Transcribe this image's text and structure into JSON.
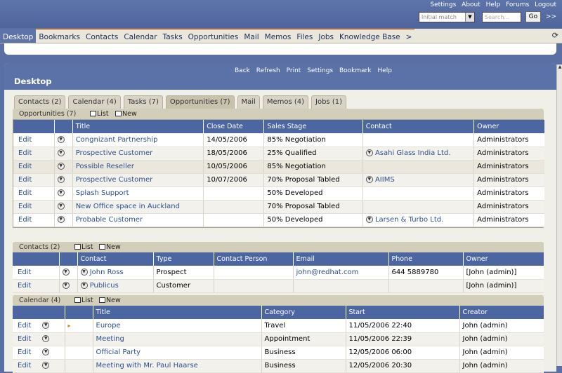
{
  "toplinks": [
    "Settings",
    "About",
    "Help",
    "Forums",
    "Logout"
  ],
  "search": {
    "match_select": "Initial match",
    "placeholder": "Search...",
    "go_label": "Go",
    "more_label": ">>"
  },
  "nav": {
    "tabs": [
      "Desktop",
      "Bookmarks",
      "Contacts",
      "Calendar",
      "Tasks",
      "Opportunities",
      "Mail",
      "Memos",
      "Files",
      "Jobs",
      "Knowledge Base",
      ">"
    ],
    "active": 0
  },
  "panel": {
    "links": [
      "Back",
      "Refresh",
      "Print",
      "Settings",
      "Bookmark",
      "Help"
    ],
    "title": "Desktop"
  },
  "subtabs": [
    "Contacts (2)",
    "Calendar (4)",
    "Tasks (7)",
    "Opportunities (7)",
    "Mail",
    "Memos (4)",
    "Jobs (1)"
  ],
  "common": {
    "edit": "Edit",
    "list": "List",
    "new": "New"
  },
  "opportunities": {
    "title": "Opportunities (7)",
    "columns": [
      "Title",
      "Close Date",
      "Sales Stage",
      "Contact",
      "Owner"
    ],
    "rows": [
      {
        "title": "Congnizant Partnership",
        "close": "14/05/2006",
        "stage": "85% Negotiation",
        "contact": "",
        "owner": "Administrators"
      },
      {
        "title": "Prospective Customer",
        "close": "18/05/2006",
        "stage": "25% Qualified",
        "contact": "Asahi Glass India Ltd.",
        "owner": "Administrators"
      },
      {
        "title": "Possible Reseller",
        "close": "10/05/2006",
        "stage": "85% Negotiation",
        "contact": "",
        "owner": "Administrators"
      },
      {
        "title": "Prospective Customer",
        "close": "10/07/2006",
        "stage": "70% Proposal Tabled",
        "contact": "AIIMS",
        "owner": "Administrators"
      },
      {
        "title": "Splash Support",
        "close": "",
        "stage": "50% Developed",
        "contact": "",
        "owner": "Administrators"
      },
      {
        "title": "New Office space in Auckland",
        "close": "",
        "stage": "70% Proposal Tabled",
        "contact": "",
        "owner": "Administrators"
      },
      {
        "title": "Probable Customer",
        "close": "",
        "stage": "50% Developed",
        "contact": "Larsen & Turbo Ltd.",
        "owner": "Administrators"
      }
    ]
  },
  "contacts": {
    "title": "Contacts (2)",
    "columns": [
      "Contact",
      "Type",
      "Contact Person",
      "Email",
      "Phone",
      "Owner"
    ],
    "rows": [
      {
        "contact": "John Ross",
        "type": "Prospect",
        "person": "",
        "email": "john@redhat.com",
        "phone": "644 5889780",
        "owner": "[John (admin)]"
      },
      {
        "contact": "Publicus",
        "type": "Customer",
        "person": "",
        "email": "",
        "phone": "",
        "owner": "[John (admin)]"
      }
    ]
  },
  "calendar": {
    "title": "Calendar (4)",
    "columns": [
      "Title",
      "Category",
      "Start",
      "Creator"
    ],
    "rows": [
      {
        "title": "Europe",
        "category": "Travel",
        "start": "11/05/2006 22:40",
        "creator": "John (admin)"
      },
      {
        "title": "Meeting",
        "category": "Appointment",
        "start": "11/05/2006 22:39",
        "creator": "John (admin)"
      },
      {
        "title": "Official Party",
        "category": "Business",
        "start": "12/05/2006 06:00",
        "creator": "John (admin)"
      },
      {
        "title": "Meeting with Mr. Paul Haarse",
        "category": "Business",
        "start": "12/05/2006 20:30",
        "creator": "John (admin)"
      }
    ]
  }
}
